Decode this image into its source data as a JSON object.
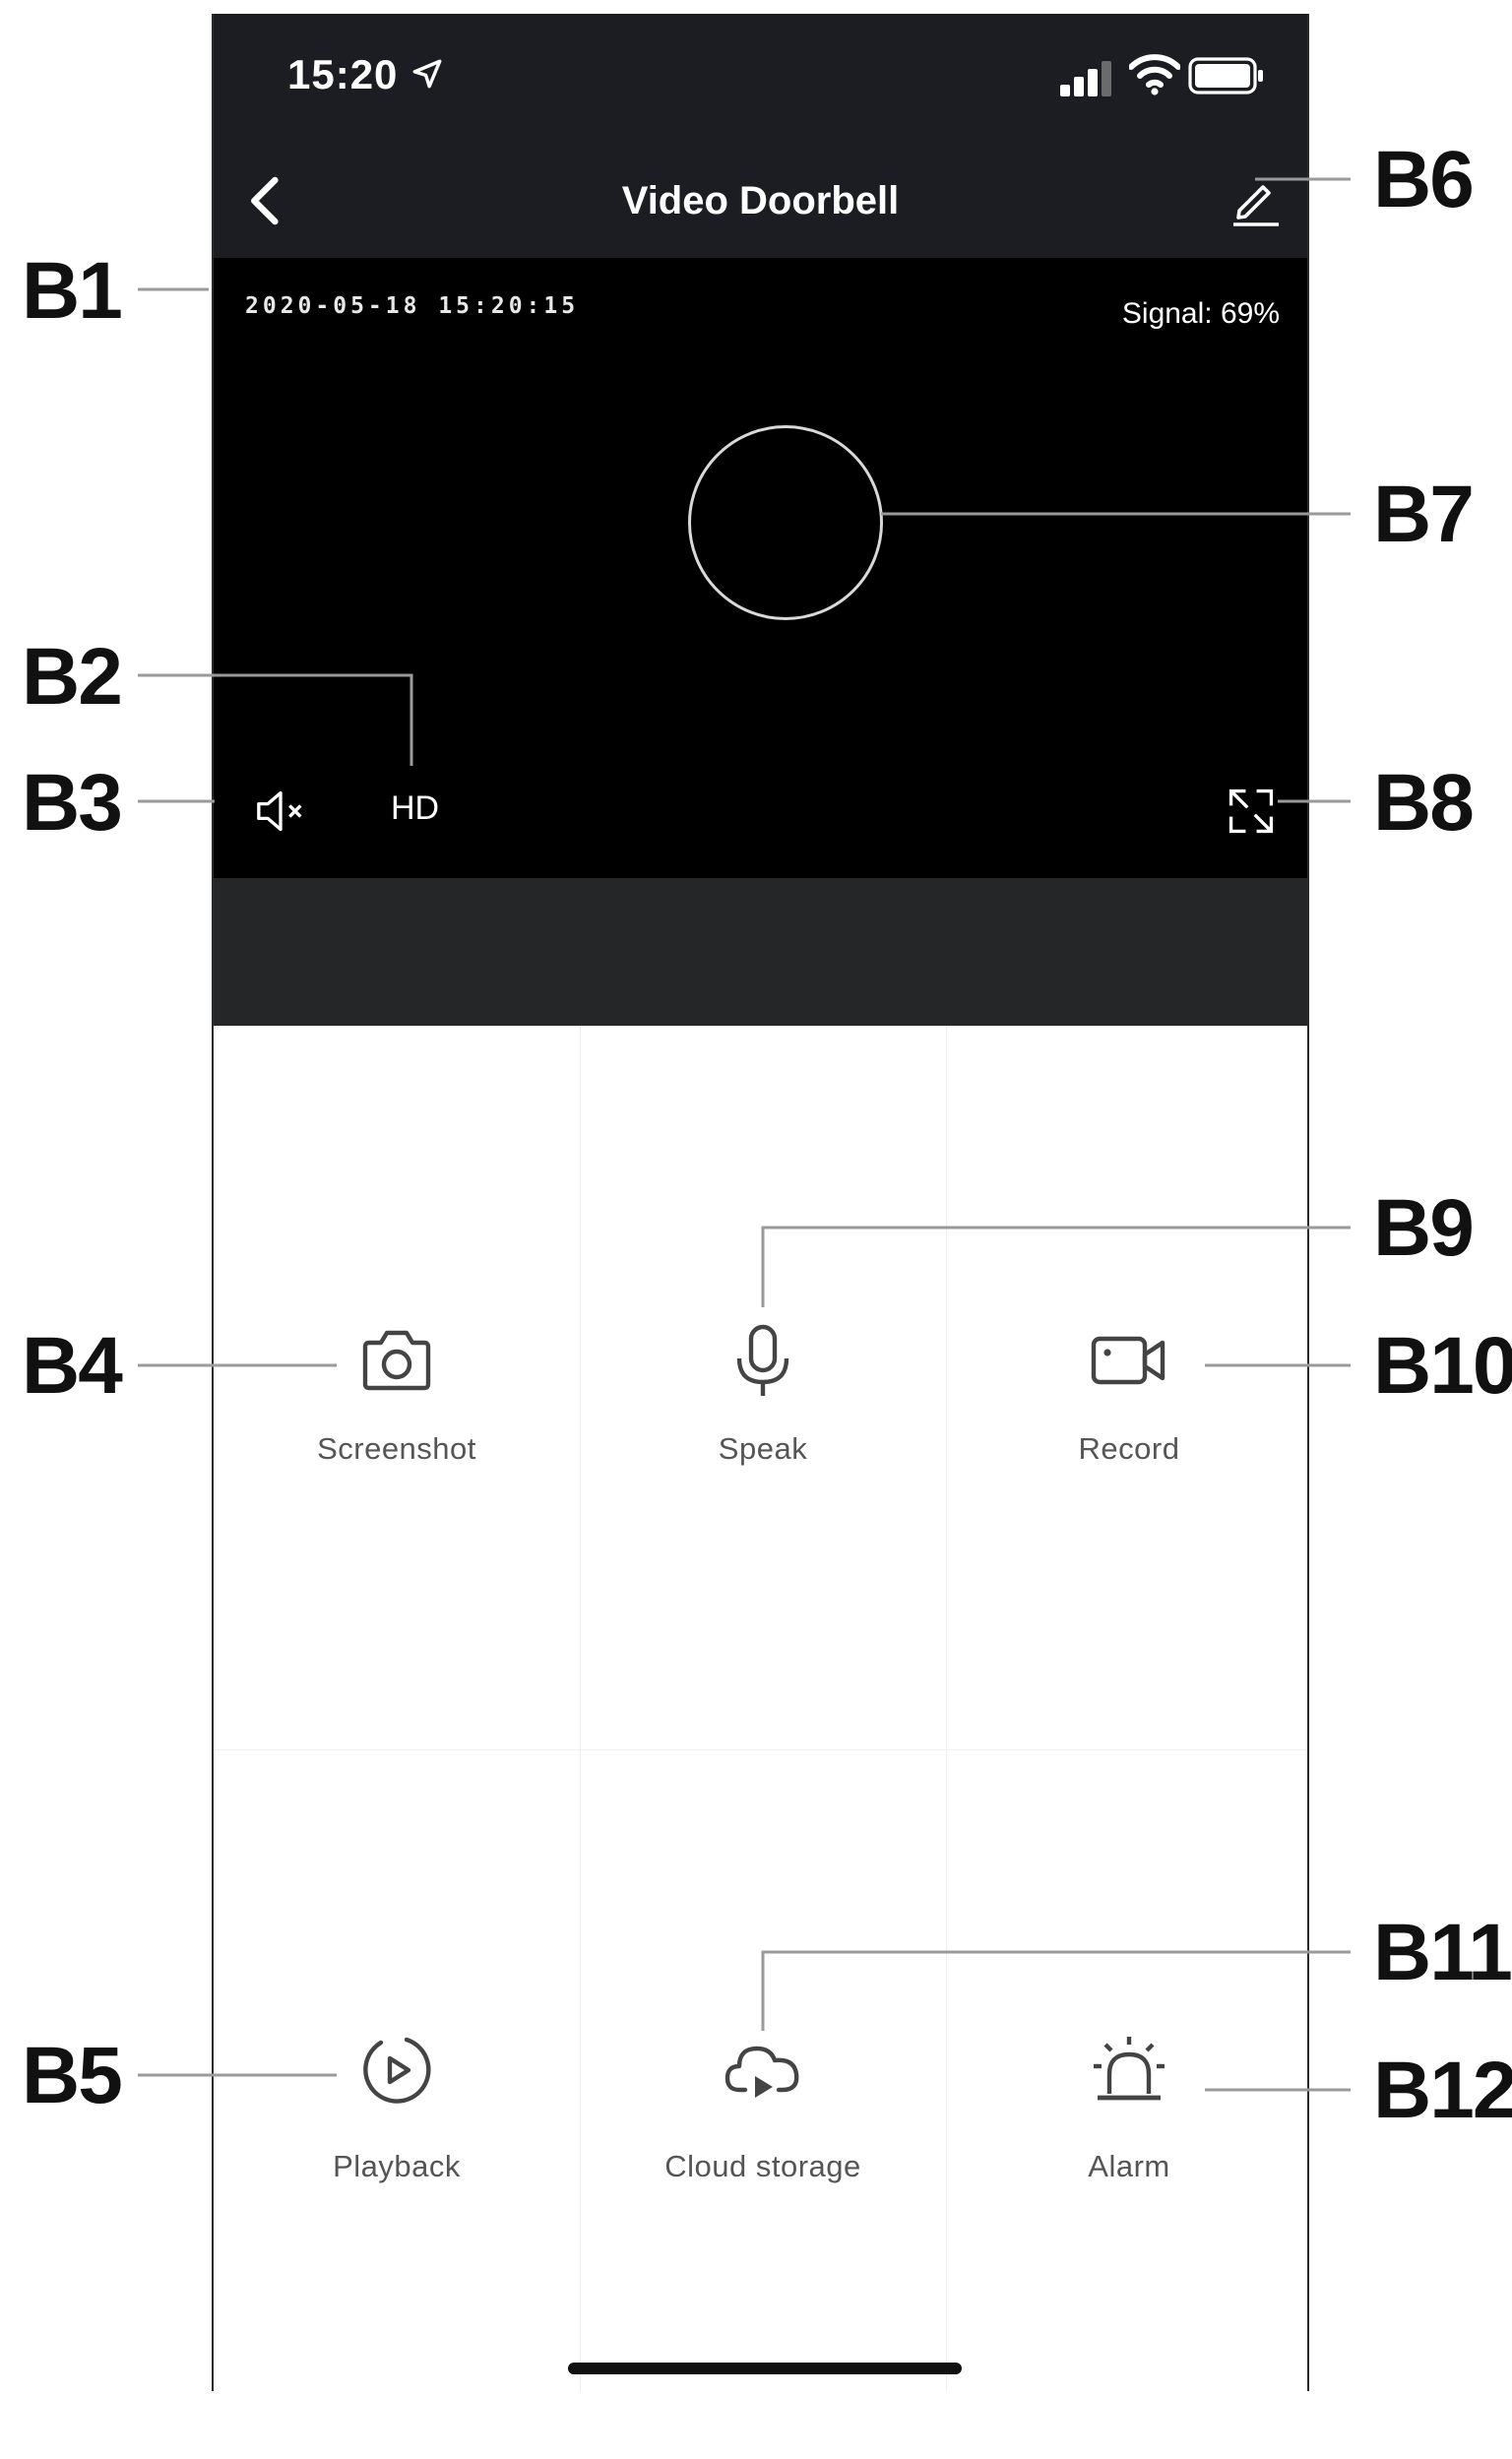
{
  "status_bar": {
    "time": "15:20",
    "location_icon": "location-arrow-icon",
    "signal_icon": "cellular-signal-icon",
    "wifi_icon": "wifi-icon",
    "battery_icon": "battery-full-icon"
  },
  "nav": {
    "back_icon": "chevron-left-icon",
    "title": "Video Doorbell",
    "edit_icon": "pencil-icon"
  },
  "video": {
    "timestamp": "2020-05-18 15:20:15",
    "signal_text": "Signal: 69%",
    "mute_icon": "speaker-muted-icon",
    "quality": "HD",
    "fullscreen_icon": "expand-icon"
  },
  "controls": [
    {
      "label": "Screenshot",
      "icon": "camera-icon"
    },
    {
      "label": "Speak",
      "icon": "microphone-icon"
    },
    {
      "label": "Record",
      "icon": "video-camera-icon"
    },
    {
      "label": "Playback",
      "icon": "playback-icon"
    },
    {
      "label": "Cloud storage",
      "icon": "cloud-play-icon"
    },
    {
      "label": "Alarm",
      "icon": "siren-icon"
    }
  ],
  "callouts": {
    "b1": "B1",
    "b2": "B2",
    "b3": "B3",
    "b4": "B4",
    "b5": "B5",
    "b6": "B6",
    "b7": "B7",
    "b8": "B8",
    "b9": "B9",
    "b10": "B10",
    "b11": "B11",
    "b12": "B12"
  },
  "colors": {
    "header_bg": "#1c1d22",
    "video_bg": "#000000",
    "strip_bg": "#252628",
    "label_gray": "#555555",
    "leader_gray": "#9a9a9a"
  }
}
